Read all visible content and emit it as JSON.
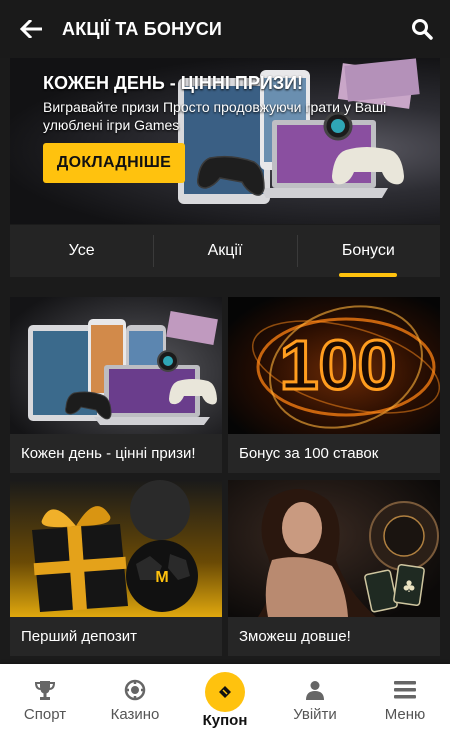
{
  "header": {
    "title": "АКЦІЇ ТА БОНУСИ",
    "back_icon": "arrow-left-icon",
    "search_icon": "search-icon"
  },
  "banner": {
    "title": "КОЖЕН ДЕНЬ - ЦІННІ ПРИЗИ!",
    "subtitle": "Вигравайте призи Просто продовжуючи грати у Ваші улюблені ігри Games",
    "button_label": "ДОКЛАДНІШЕ"
  },
  "tabs": [
    {
      "label": "Усе",
      "active": false
    },
    {
      "label": "Акції",
      "active": false
    },
    {
      "label": "Бонуси",
      "active": true
    }
  ],
  "cards": [
    {
      "label": "Кожен день - цінні призи!"
    },
    {
      "label": "Бонус за 100 ставок",
      "image_text": "100"
    },
    {
      "label": "Перший депозит"
    },
    {
      "label": "Зможеш довше!"
    }
  ],
  "bottom_nav": [
    {
      "label": "Спорт",
      "icon": "trophy-icon"
    },
    {
      "label": "Казино",
      "icon": "chip-icon"
    },
    {
      "label": "Купон",
      "icon": "ticket-icon",
      "highlighted": true
    },
    {
      "label": "Увійти",
      "icon": "user-icon"
    },
    {
      "label": "Меню",
      "icon": "hamburger-icon"
    }
  ],
  "colors": {
    "accent": "#ffc20e",
    "background": "#1b1b1b",
    "card": "#262626",
    "nav_bg": "#ffffff"
  }
}
